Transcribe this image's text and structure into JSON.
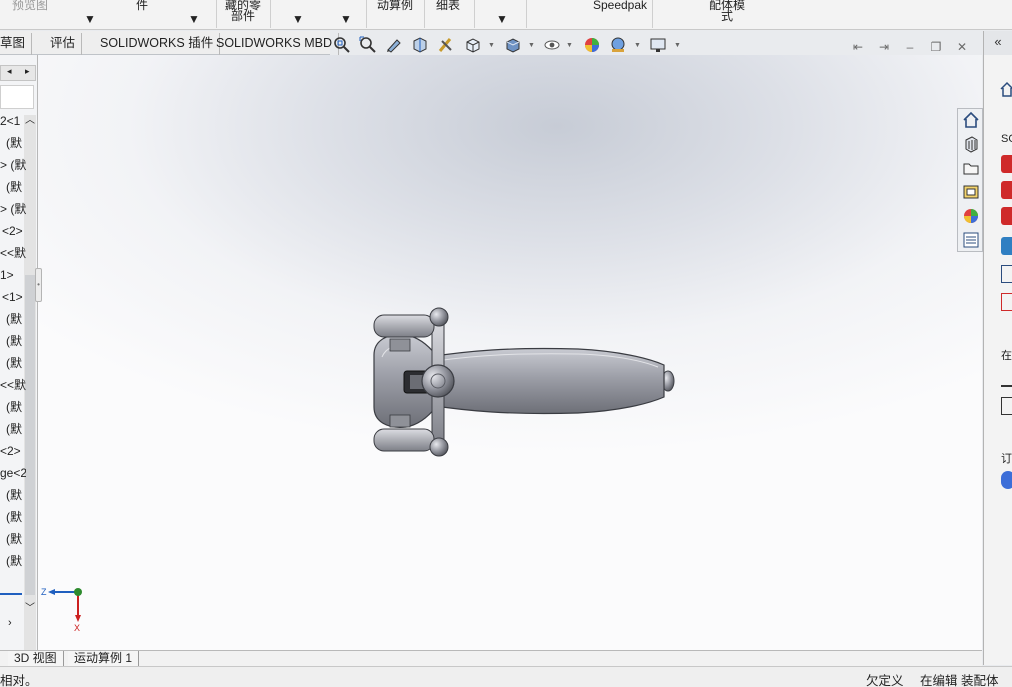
{
  "ribbon": {
    "items": [
      {
        "lines": [
          "预览图"
        ],
        "dropdown": false
      },
      {
        "lines": [
          "件"
        ],
        "dropdown": false
      },
      {
        "lines": [
          "藏的零",
          "部件"
        ],
        "dropdown": false
      },
      {
        "lines": [
          "动算例"
        ],
        "dropdown": false
      },
      {
        "lines": [
          "细表"
        ],
        "dropdown": false
      },
      {
        "lines": [
          "Speedpak"
        ],
        "dropdown": false
      },
      {
        "lines": [
          "配体模",
          "式"
        ],
        "dropdown": false
      }
    ]
  },
  "tabs": [
    "草图",
    "评估",
    "SOLIDWORKS 插件",
    "SOLIDWORKS MBD"
  ],
  "hud_icons": [
    "zoom-to-fit-icon",
    "zoom-area-icon",
    "previous-view-icon",
    "section-view-icon",
    "dynamic-annotation-icon",
    "view-orientation-icon",
    "display-style-icon",
    "hide-show-icon",
    "edit-appearance-icon",
    "apply-scene-icon",
    "view-settings-icon"
  ],
  "feature_tree": {
    "items": [
      "2<1",
      "(默",
      "> (默",
      "(默",
      "> (默",
      "<2>",
      "<<默",
      "1>",
      "<1>",
      "(默",
      "(默",
      "(默",
      "<<默",
      "(默",
      "(默",
      "<2>",
      "ge<2",
      "(默",
      "(默",
      "(默",
      "(默"
    ]
  },
  "task_pane": {
    "labels": [
      "SO",
      "在",
      "订"
    ]
  },
  "triad": {
    "z_label": "Z",
    "x_label": "X"
  },
  "bottom_tabs": [
    "3D 视图",
    "运动算例 1"
  ],
  "status": {
    "left": "相对。",
    "underdefined": "欠定义",
    "editing": "在编辑 装配体"
  },
  "colors": {
    "accent_blue": "#1f5fbf",
    "triad_green": "#2e8b2e",
    "triad_red": "#cc2020",
    "model_gray": "#9a9ca3"
  }
}
